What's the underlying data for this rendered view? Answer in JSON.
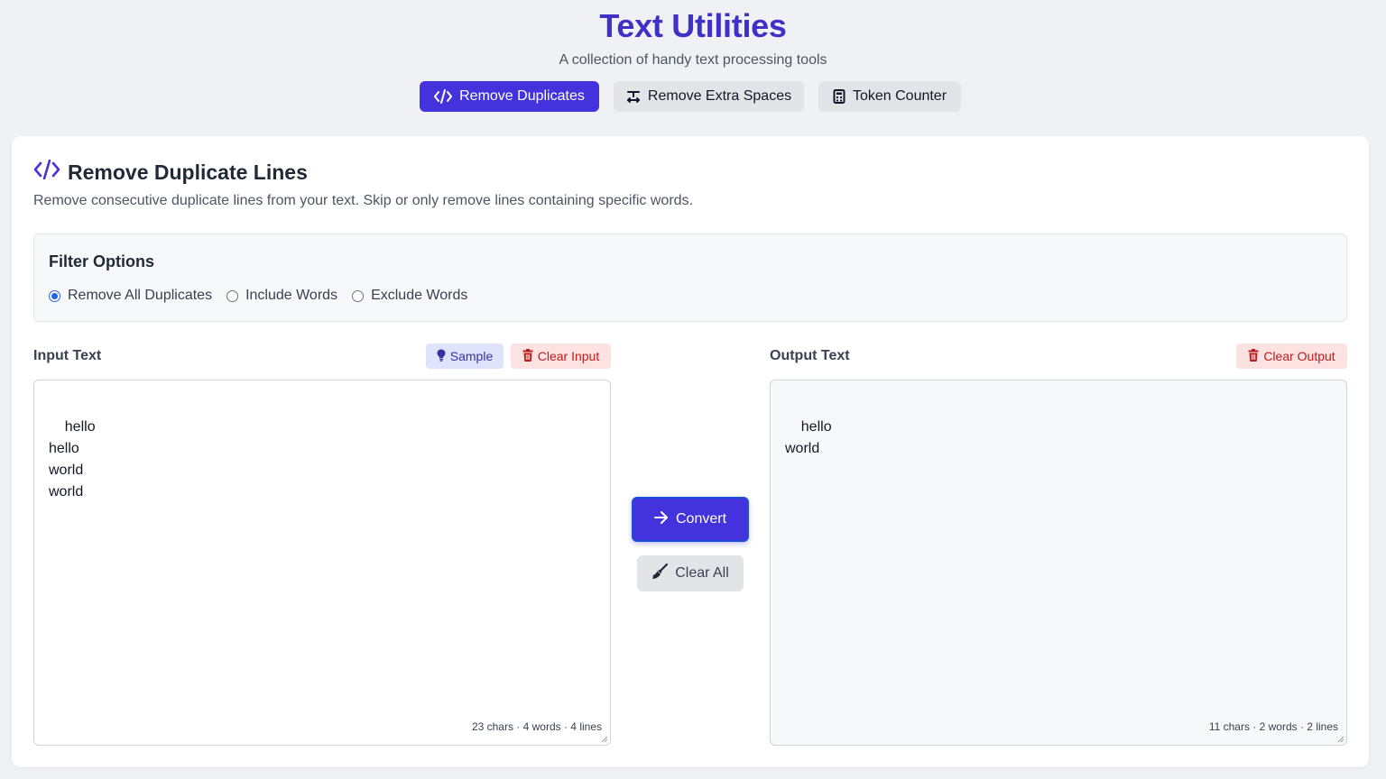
{
  "header": {
    "title": "Text Utilities",
    "subtitle": "A collection of handy text processing tools"
  },
  "tabs": [
    {
      "label": "Remove Duplicates",
      "icon": "code-icon",
      "active": true
    },
    {
      "label": "Remove Extra Spaces",
      "icon": "text-spacing-icon",
      "active": false
    },
    {
      "label": "Token Counter",
      "icon": "calculator-icon",
      "active": false
    }
  ],
  "tool": {
    "title": "Remove Duplicate Lines",
    "description": "Remove consecutive duplicate lines from your text. Skip or only remove lines containing specific words."
  },
  "filter": {
    "title": "Filter Options",
    "options": [
      {
        "label": "Remove All Duplicates",
        "checked": true
      },
      {
        "label": "Include Words",
        "checked": false
      },
      {
        "label": "Exclude Words",
        "checked": false
      }
    ]
  },
  "input": {
    "label": "Input Text",
    "sample_label": "Sample",
    "clear_label": "Clear Input",
    "value": "hello\nhello\nworld\nworld",
    "stats": "23 chars · 4 words · 4 lines"
  },
  "output": {
    "label": "Output Text",
    "clear_label": "Clear Output",
    "value": "hello\nworld",
    "stats": "11 chars · 2 words · 2 lines"
  },
  "actions": {
    "convert_label": "Convert",
    "clear_all_label": "Clear All"
  },
  "colors": {
    "accent": "#4433dd",
    "title": "#4030c8",
    "danger": "#b91c1c",
    "background": "#f0f1f5"
  }
}
